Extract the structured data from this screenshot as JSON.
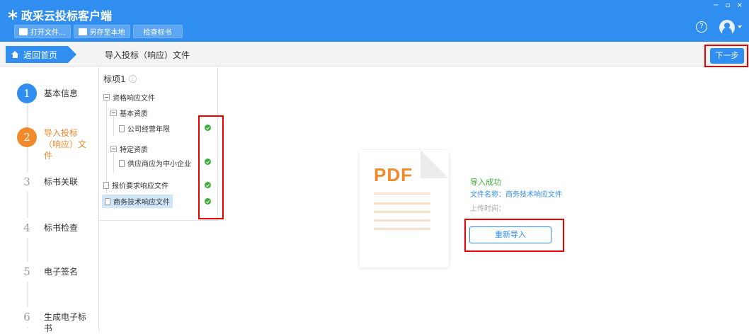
{
  "app": {
    "title": "政采云投标客户端",
    "window_controls": "− ▫ ×"
  },
  "toolbar": {
    "open_label": "打开文件...",
    "save_label": "另存至本地",
    "check_label": "检查标书"
  },
  "header": {
    "help_symbol": "?"
  },
  "nav": {
    "home_label": "返回首页",
    "section_title": "导入投标（响应）文件",
    "next_label": "下一步"
  },
  "steps": [
    {
      "num": "1",
      "label": "基本信息",
      "state": "done"
    },
    {
      "num": "2",
      "label": "导入投标（响应）文件",
      "state": "active"
    },
    {
      "num": "3",
      "label": "标书关联",
      "state": "todo"
    },
    {
      "num": "4",
      "label": "标书检查",
      "state": "todo"
    },
    {
      "num": "5",
      "label": "电子签名",
      "state": "todo"
    },
    {
      "num": "6",
      "label": "生成电子标书",
      "state": "todo"
    }
  ],
  "tree": {
    "head": "标项1",
    "info": "i",
    "nodes": {
      "qual": "资格响应文件",
      "basic": "基本资质",
      "years": "公司经营年限",
      "special": "特定资质",
      "sme": "供应商应为中小企业",
      "price": "报价要求响应文件",
      "biz": "商务技术响应文件"
    }
  },
  "result": {
    "pdf": "PDF",
    "status": "导入成功",
    "file_name": "文件名称：商务技术响应文件",
    "upload_time": "上传时间：",
    "reimport_label": "重新导入"
  },
  "colors": {
    "primary": "#2f8ef0",
    "active_step": "#f08a2b",
    "success": "#3aad3a",
    "highlight": "#e00000"
  }
}
